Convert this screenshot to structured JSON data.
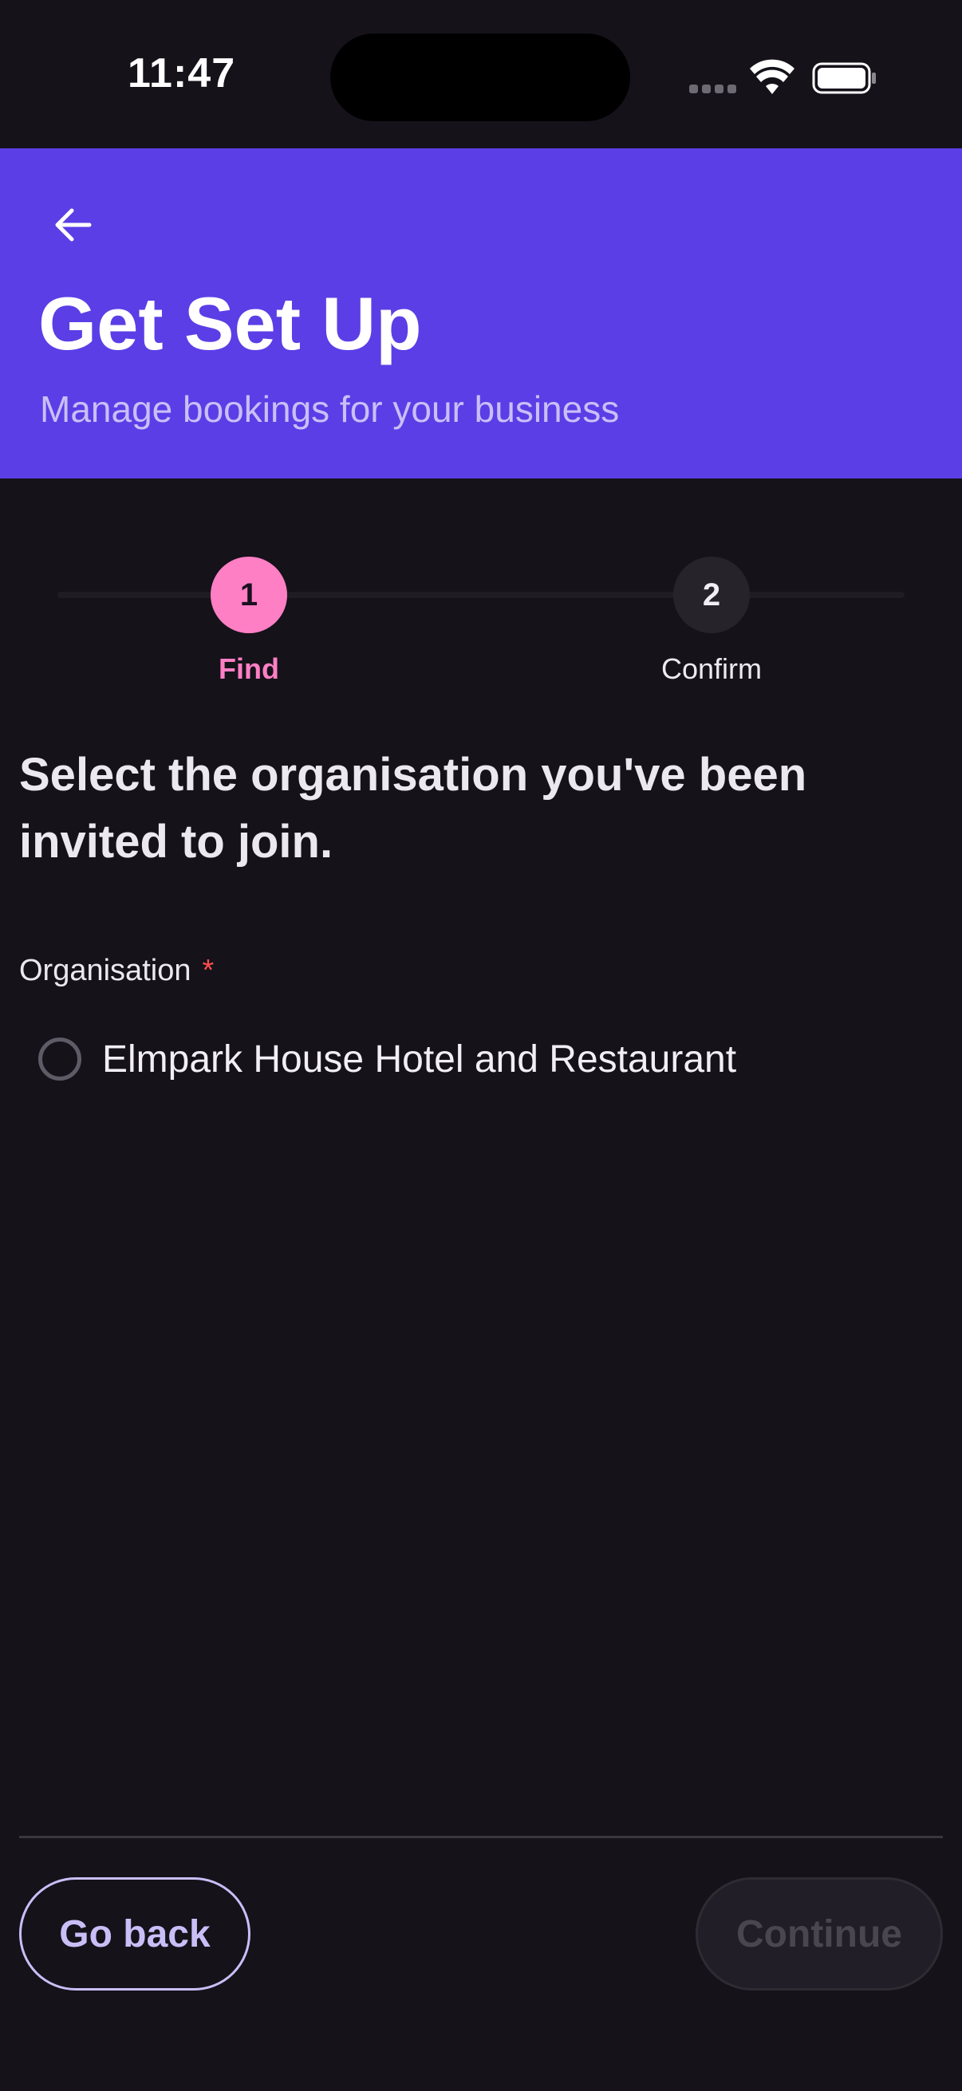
{
  "status_bar": {
    "time": "11:47"
  },
  "header": {
    "back_icon": "arrow-left-icon",
    "title": "Get Set Up",
    "subtitle": "Manage bookings for your business",
    "background_color": "#5b3ee6"
  },
  "stepper": {
    "steps": [
      {
        "number": "1",
        "label": "Find",
        "state": "active"
      },
      {
        "number": "2",
        "label": "Confirm",
        "state": "inactive"
      }
    ],
    "active_color": "#ff7fc5"
  },
  "form": {
    "prompt": "Select the organisation you've been invited to join.",
    "field_label": "Organisation",
    "required_mark": "*",
    "options": [
      {
        "label": "Elmpark House Hotel and Restaurant",
        "selected": false
      }
    ]
  },
  "footer": {
    "back_label": "Go back",
    "continue_label": "Continue",
    "continue_disabled": true
  }
}
